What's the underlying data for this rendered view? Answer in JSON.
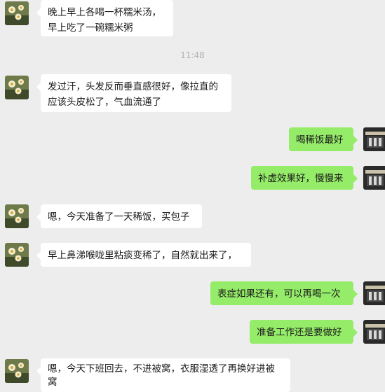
{
  "chat": {
    "timestamp": "11:48",
    "messages": [
      {
        "side": "in",
        "text": "晚上早上各喝一杯糯米汤，\n早上吃了一碗糯米粥"
      },
      {
        "side": "in",
        "text": "发过汗，头发反而垂直感很好，像拉直的\n应该头皮松了，气血流通了"
      },
      {
        "side": "out",
        "text": "喝稀饭最好"
      },
      {
        "side": "out",
        "text": "补虚效果好，慢慢来"
      },
      {
        "side": "in",
        "text": "嗯，今天准备了一天稀饭，买包子"
      },
      {
        "side": "in",
        "text": "早上鼻涕喉咙里粘痰变稀了，自然就出来了，"
      },
      {
        "side": "out",
        "text": "表症如果还有，可以再喝一次"
      },
      {
        "side": "out",
        "text": "准备工作还是要做好"
      },
      {
        "side": "in",
        "text": "嗯，今天下班回去，不进被窝，衣服湿透了再换好进被\n窝"
      }
    ]
  },
  "colors": {
    "outgoing_bubble": "#95ec69",
    "incoming_bubble": "#ffffff",
    "background": "#ededed"
  },
  "icons": {
    "incoming_avatar": "flower-photo-avatar",
    "outgoing_avatar": "building-photo-avatar"
  }
}
